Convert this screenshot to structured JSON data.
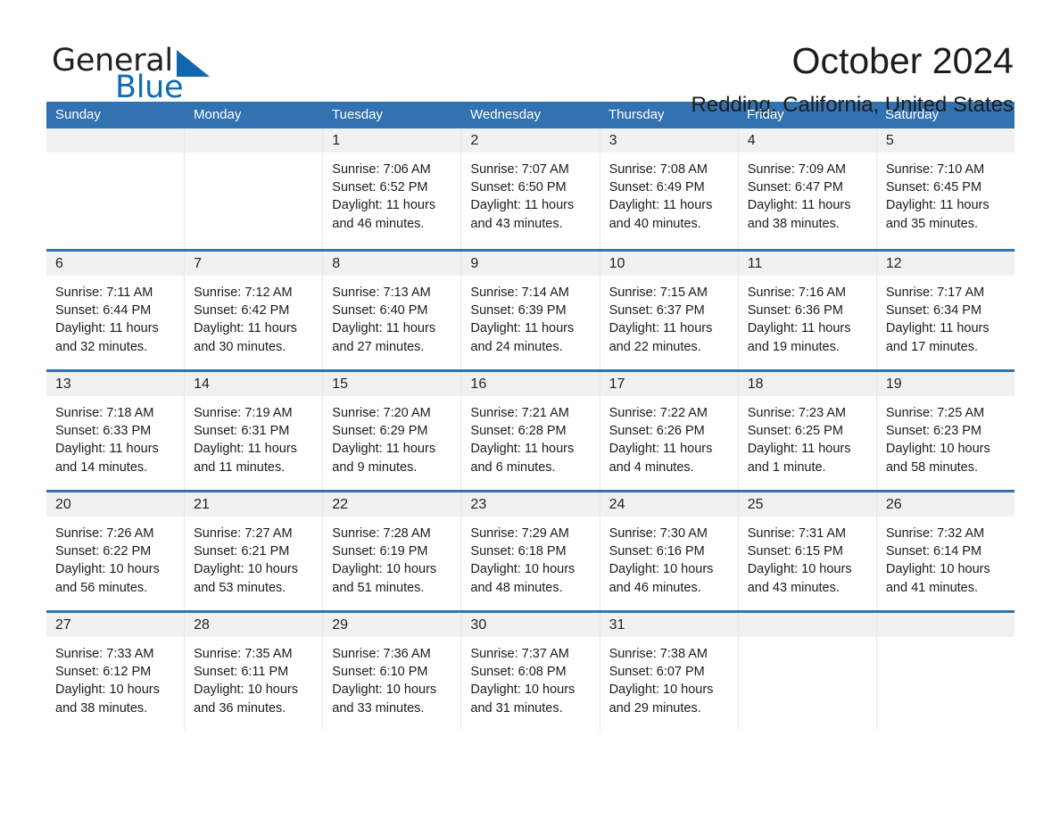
{
  "logo": {
    "word_one": "General",
    "word_two": "Blue",
    "triangle_icon": "triangle-icon"
  },
  "header": {
    "month_title": "October 2024",
    "location": "Redding, California, United States"
  },
  "calendar": {
    "weekdays": [
      "Sunday",
      "Monday",
      "Tuesday",
      "Wednesday",
      "Thursday",
      "Friday",
      "Saturday"
    ],
    "accent_color": "#3372b0",
    "day_band_color": "#f1f1f1",
    "weeks": [
      [
        {
          "day": "",
          "empty": true
        },
        {
          "day": "",
          "empty": true
        },
        {
          "day": "1",
          "sunrise": "Sunrise: 7:06 AM",
          "sunset": "Sunset: 6:52 PM",
          "daylight_1": "Daylight: 11 hours",
          "daylight_2": "and 46 minutes."
        },
        {
          "day": "2",
          "sunrise": "Sunrise: 7:07 AM",
          "sunset": "Sunset: 6:50 PM",
          "daylight_1": "Daylight: 11 hours",
          "daylight_2": "and 43 minutes."
        },
        {
          "day": "3",
          "sunrise": "Sunrise: 7:08 AM",
          "sunset": "Sunset: 6:49 PM",
          "daylight_1": "Daylight: 11 hours",
          "daylight_2": "and 40 minutes."
        },
        {
          "day": "4",
          "sunrise": "Sunrise: 7:09 AM",
          "sunset": "Sunset: 6:47 PM",
          "daylight_1": "Daylight: 11 hours",
          "daylight_2": "and 38 minutes."
        },
        {
          "day": "5",
          "sunrise": "Sunrise: 7:10 AM",
          "sunset": "Sunset: 6:45 PM",
          "daylight_1": "Daylight: 11 hours",
          "daylight_2": "and 35 minutes."
        }
      ],
      [
        {
          "day": "6",
          "sunrise": "Sunrise: 7:11 AM",
          "sunset": "Sunset: 6:44 PM",
          "daylight_1": "Daylight: 11 hours",
          "daylight_2": "and 32 minutes."
        },
        {
          "day": "7",
          "sunrise": "Sunrise: 7:12 AM",
          "sunset": "Sunset: 6:42 PM",
          "daylight_1": "Daylight: 11 hours",
          "daylight_2": "and 30 minutes."
        },
        {
          "day": "8",
          "sunrise": "Sunrise: 7:13 AM",
          "sunset": "Sunset: 6:40 PM",
          "daylight_1": "Daylight: 11 hours",
          "daylight_2": "and 27 minutes."
        },
        {
          "day": "9",
          "sunrise": "Sunrise: 7:14 AM",
          "sunset": "Sunset: 6:39 PM",
          "daylight_1": "Daylight: 11 hours",
          "daylight_2": "and 24 minutes."
        },
        {
          "day": "10",
          "sunrise": "Sunrise: 7:15 AM",
          "sunset": "Sunset: 6:37 PM",
          "daylight_1": "Daylight: 11 hours",
          "daylight_2": "and 22 minutes."
        },
        {
          "day": "11",
          "sunrise": "Sunrise: 7:16 AM",
          "sunset": "Sunset: 6:36 PM",
          "daylight_1": "Daylight: 11 hours",
          "daylight_2": "and 19 minutes."
        },
        {
          "day": "12",
          "sunrise": "Sunrise: 7:17 AM",
          "sunset": "Sunset: 6:34 PM",
          "daylight_1": "Daylight: 11 hours",
          "daylight_2": "and 17 minutes."
        }
      ],
      [
        {
          "day": "13",
          "sunrise": "Sunrise: 7:18 AM",
          "sunset": "Sunset: 6:33 PM",
          "daylight_1": "Daylight: 11 hours",
          "daylight_2": "and 14 minutes."
        },
        {
          "day": "14",
          "sunrise": "Sunrise: 7:19 AM",
          "sunset": "Sunset: 6:31 PM",
          "daylight_1": "Daylight: 11 hours",
          "daylight_2": "and 11 minutes."
        },
        {
          "day": "15",
          "sunrise": "Sunrise: 7:20 AM",
          "sunset": "Sunset: 6:29 PM",
          "daylight_1": "Daylight: 11 hours",
          "daylight_2": "and 9 minutes."
        },
        {
          "day": "16",
          "sunrise": "Sunrise: 7:21 AM",
          "sunset": "Sunset: 6:28 PM",
          "daylight_1": "Daylight: 11 hours",
          "daylight_2": "and 6 minutes."
        },
        {
          "day": "17",
          "sunrise": "Sunrise: 7:22 AM",
          "sunset": "Sunset: 6:26 PM",
          "daylight_1": "Daylight: 11 hours",
          "daylight_2": "and 4 minutes."
        },
        {
          "day": "18",
          "sunrise": "Sunrise: 7:23 AM",
          "sunset": "Sunset: 6:25 PM",
          "daylight_1": "Daylight: 11 hours",
          "daylight_2": "and 1 minute."
        },
        {
          "day": "19",
          "sunrise": "Sunrise: 7:25 AM",
          "sunset": "Sunset: 6:23 PM",
          "daylight_1": "Daylight: 10 hours",
          "daylight_2": "and 58 minutes."
        }
      ],
      [
        {
          "day": "20",
          "sunrise": "Sunrise: 7:26 AM",
          "sunset": "Sunset: 6:22 PM",
          "daylight_1": "Daylight: 10 hours",
          "daylight_2": "and 56 minutes."
        },
        {
          "day": "21",
          "sunrise": "Sunrise: 7:27 AM",
          "sunset": "Sunset: 6:21 PM",
          "daylight_1": "Daylight: 10 hours",
          "daylight_2": "and 53 minutes."
        },
        {
          "day": "22",
          "sunrise": "Sunrise: 7:28 AM",
          "sunset": "Sunset: 6:19 PM",
          "daylight_1": "Daylight: 10 hours",
          "daylight_2": "and 51 minutes."
        },
        {
          "day": "23",
          "sunrise": "Sunrise: 7:29 AM",
          "sunset": "Sunset: 6:18 PM",
          "daylight_1": "Daylight: 10 hours",
          "daylight_2": "and 48 minutes."
        },
        {
          "day": "24",
          "sunrise": "Sunrise: 7:30 AM",
          "sunset": "Sunset: 6:16 PM",
          "daylight_1": "Daylight: 10 hours",
          "daylight_2": "and 46 minutes."
        },
        {
          "day": "25",
          "sunrise": "Sunrise: 7:31 AM",
          "sunset": "Sunset: 6:15 PM",
          "daylight_1": "Daylight: 10 hours",
          "daylight_2": "and 43 minutes."
        },
        {
          "day": "26",
          "sunrise": "Sunrise: 7:32 AM",
          "sunset": "Sunset: 6:14 PM",
          "daylight_1": "Daylight: 10 hours",
          "daylight_2": "and 41 minutes."
        }
      ],
      [
        {
          "day": "27",
          "sunrise": "Sunrise: 7:33 AM",
          "sunset": "Sunset: 6:12 PM",
          "daylight_1": "Daylight: 10 hours",
          "daylight_2": "and 38 minutes."
        },
        {
          "day": "28",
          "sunrise": "Sunrise: 7:35 AM",
          "sunset": "Sunset: 6:11 PM",
          "daylight_1": "Daylight: 10 hours",
          "daylight_2": "and 36 minutes."
        },
        {
          "day": "29",
          "sunrise": "Sunrise: 7:36 AM",
          "sunset": "Sunset: 6:10 PM",
          "daylight_1": "Daylight: 10 hours",
          "daylight_2": "and 33 minutes."
        },
        {
          "day": "30",
          "sunrise": "Sunrise: 7:37 AM",
          "sunset": "Sunset: 6:08 PM",
          "daylight_1": "Daylight: 10 hours",
          "daylight_2": "and 31 minutes."
        },
        {
          "day": "31",
          "sunrise": "Sunrise: 7:38 AM",
          "sunset": "Sunset: 6:07 PM",
          "daylight_1": "Daylight: 10 hours",
          "daylight_2": "and 29 minutes."
        },
        {
          "day": "",
          "empty": true
        },
        {
          "day": "",
          "empty": true
        }
      ]
    ]
  }
}
